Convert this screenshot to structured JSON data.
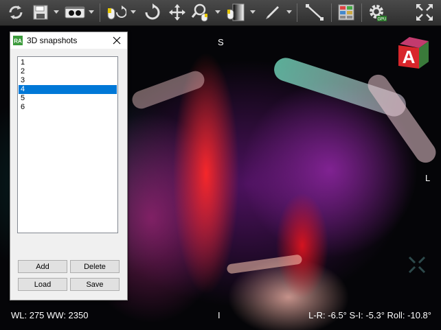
{
  "toolbar": {
    "tools": [
      {
        "icon": "sync-icon"
      },
      {
        "icon": "save-icon"
      },
      {
        "icon": "stereo-view-icon"
      },
      {
        "icon": "mouse-rotate-icon"
      },
      {
        "icon": "rotate-icon"
      },
      {
        "icon": "pan-icon"
      },
      {
        "icon": "zoom-icon"
      },
      {
        "icon": "window-level-icon"
      },
      {
        "icon": "pen-icon"
      },
      {
        "icon": "measure-line-icon"
      },
      {
        "icon": "layout-grid-icon"
      },
      {
        "icon": "gpu-settings-icon"
      },
      {
        "icon": "fullscreen-icon"
      }
    ],
    "gpu_badge": "GPU"
  },
  "dialog": {
    "title": "3D snapshots",
    "items": [
      "1",
      "2",
      "3",
      "4",
      "5",
      "6"
    ],
    "selected_index": 3,
    "add_label": "Add",
    "delete_label": "Delete",
    "load_label": "Load",
    "save_label": "Save"
  },
  "viewport": {
    "orientation_top": "S",
    "orientation_right": "L",
    "orientation_bottom": "I",
    "window_level": "WL: 275 WW: 2350",
    "angles": "L-R: -6.5° S-I: -5.3° Roll: -10.8°",
    "cube_face": "A"
  },
  "colors": {
    "selection": "#0078d7",
    "cube_red": "#d8262b",
    "toolbar": "#3a3a3a"
  }
}
